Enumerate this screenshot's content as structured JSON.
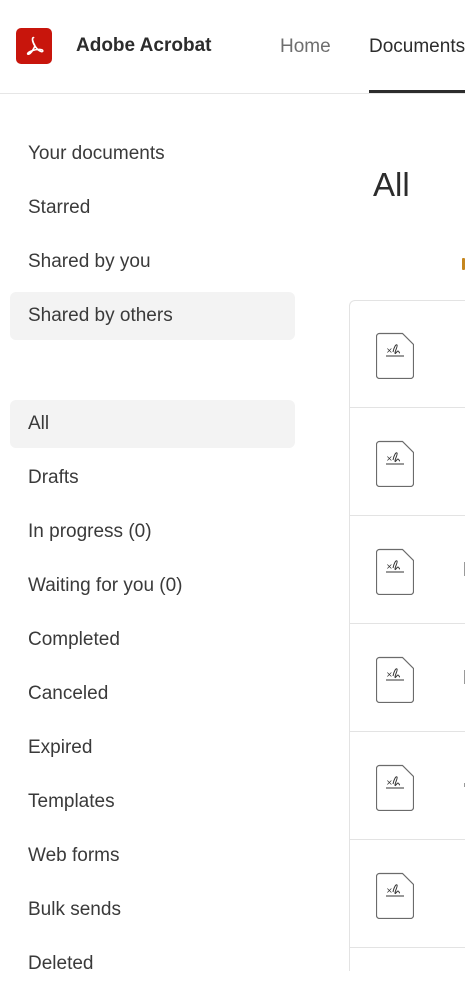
{
  "header": {
    "app_name": "Adobe Acrobat",
    "tabs": [
      {
        "label": "Home"
      },
      {
        "label": "Documents"
      }
    ],
    "brand_color": "#c8150c"
  },
  "sidebar": {
    "groups": [
      {
        "items": [
          {
            "label": "Your documents",
            "active": false
          },
          {
            "label": "Starred",
            "active": false
          },
          {
            "label": "Shared by you",
            "active": false
          },
          {
            "label": "Shared by others",
            "active": true
          }
        ]
      },
      {
        "items": [
          {
            "label": "All",
            "active": true
          },
          {
            "label": "Drafts",
            "active": false
          },
          {
            "label": "In progress (0)",
            "active": false
          },
          {
            "label": "Waiting for you (0)",
            "active": false
          },
          {
            "label": "Completed",
            "active": false
          },
          {
            "label": "Canceled",
            "active": false
          },
          {
            "label": "Expired",
            "active": false
          },
          {
            "label": "Templates",
            "active": false
          },
          {
            "label": "Web forms",
            "active": false
          },
          {
            "label": "Bulk sends",
            "active": false
          },
          {
            "label": "Deleted",
            "active": false
          }
        ]
      }
    ]
  },
  "main": {
    "title": "All",
    "document_rows": [
      {
        "icon": "signature-document-icon"
      },
      {
        "icon": "signature-document-icon"
      },
      {
        "icon": "signature-document-icon"
      },
      {
        "icon": "signature-document-icon"
      },
      {
        "icon": "signature-document-icon"
      },
      {
        "icon": "signature-document-icon"
      }
    ]
  }
}
